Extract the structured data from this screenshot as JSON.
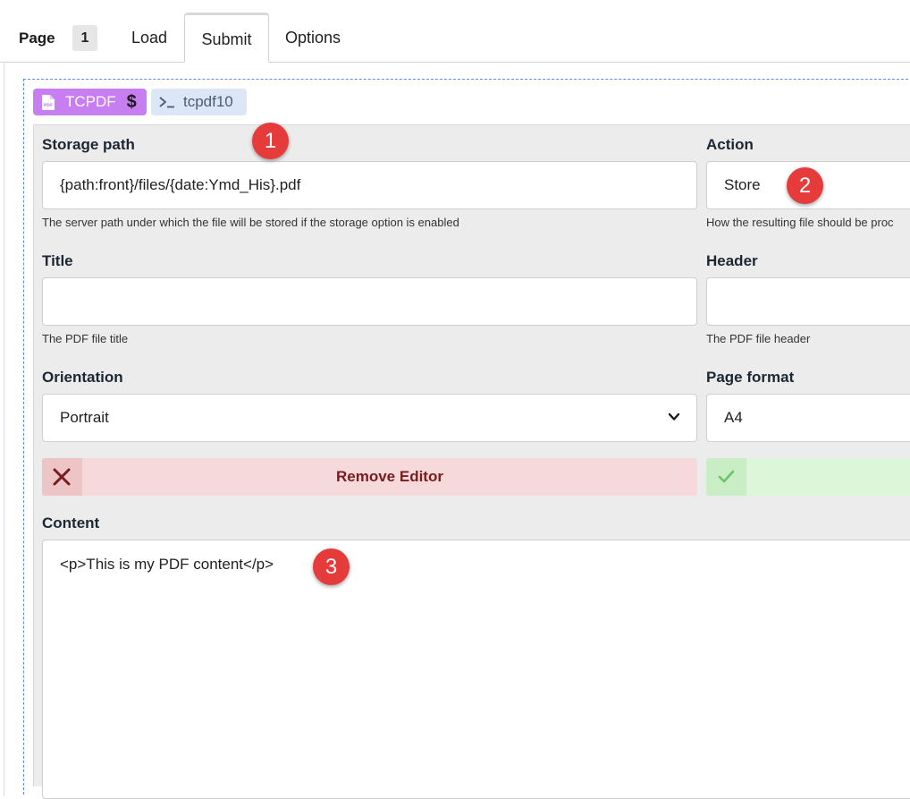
{
  "tabbar": {
    "page_label": "Page",
    "page_number": "1",
    "tabs": [
      {
        "label": "Load"
      },
      {
        "label": "Submit",
        "active": true
      },
      {
        "label": "Options"
      }
    ]
  },
  "badges": {
    "tcpdf": {
      "label": "TCPDF",
      "suffix": "$",
      "icon": "pdf-file-icon",
      "color": "#c77ef0"
    },
    "terminal": {
      "label": "tcpdf10",
      "icon": "terminal-icon",
      "color": "#dbe6f7"
    }
  },
  "form": {
    "storage_path": {
      "label": "Storage path",
      "value": "{path:front}/files/{date:Ymd_His}.pdf",
      "help": "The server path under which the file will be stored if the storage option is enabled"
    },
    "action": {
      "label": "Action",
      "value": "Store",
      "help": "How the resulting file should be proc"
    },
    "title": {
      "label": "Title",
      "value": "",
      "help": "The PDF file title"
    },
    "header": {
      "label": "Header",
      "value": "",
      "help": "The PDF file header"
    },
    "orientation": {
      "label": "Orientation",
      "value": "Portrait"
    },
    "page_format": {
      "label": "Page format",
      "value": "A4"
    },
    "remove_editor": {
      "label": "Remove Editor",
      "color": "#f6dadb"
    },
    "confirm": {
      "icon": "check-icon",
      "color": "#dbf6d9"
    },
    "content": {
      "label": "Content",
      "value": "<p>This is my PDF content</p>"
    }
  },
  "markers": [
    "1",
    "2",
    "3"
  ],
  "colors": {
    "marker": "#e53b3b",
    "dashed_border": "#5b8ee8"
  }
}
